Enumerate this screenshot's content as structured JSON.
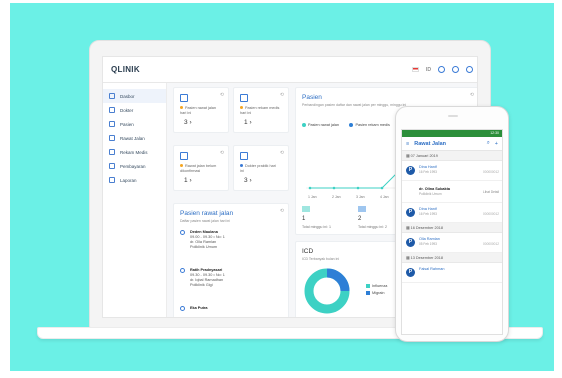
{
  "app": {
    "logo": "QLINIK",
    "language": "ID"
  },
  "sidebar": {
    "items": [
      {
        "label": "Dasbor"
      },
      {
        "label": "Dokter"
      },
      {
        "label": "Pasien"
      },
      {
        "label": "Rawat Jalan"
      },
      {
        "label": "Rekam Medis"
      },
      {
        "label": "Pembayaran"
      },
      {
        "label": "Laporan"
      }
    ]
  },
  "stats": [
    {
      "label": "Pasien rawat jalan hari ini",
      "value": "3"
    },
    {
      "label": "Pasien rekam medis hari ini",
      "value": "1"
    },
    {
      "label": "Rawat jalan belum dikonfirmasi",
      "value": "1"
    },
    {
      "label": "Dokter praktik hari ini",
      "value": "3"
    }
  ],
  "pasien_chart": {
    "title": "Pasien",
    "subtitle": "Perbandingan pasien daftar dan rawat jalan per minggu, minggu ini",
    "legend": [
      "Pasien rawat jalan",
      "Pasien rekam medis"
    ],
    "colors": {
      "rawat": "#3dd1c4",
      "rekam": "#2e7fd6"
    },
    "x_ticks": [
      "1 Jan",
      "2 Jan",
      "3 Jan",
      "4 Jan"
    ],
    "summary": [
      {
        "value": "1",
        "label": "Total minggu ini: 1"
      },
      {
        "value": "2",
        "label": "Total minggu ini: 2"
      }
    ]
  },
  "rawat_jalan": {
    "title": "Pasien rawat jalan",
    "subtitle": "Daftar pasien rawat jalan hari ini",
    "items": [
      {
        "name": "Deden Maulana",
        "time": "09.00 - 09.30 • No: 1",
        "doctor": "dr. Olla Ramlan",
        "poli": "Poliklinik Umum"
      },
      {
        "name": "Ratih Pradnyasari",
        "time": "09.30 - 09.30 • No: 1",
        "doctor": "dr. Iqbal Ramadhan",
        "poli": "Poliklinik Gigi"
      },
      {
        "name": "Eka Putra",
        "time": "",
        "doctor": "",
        "poli": ""
      }
    ]
  },
  "icd": {
    "title": "ICD",
    "subtitle": "ICD Terbanyak bulan ini",
    "legend": [
      "Influenza",
      "Migrain"
    ],
    "colors": {
      "influenza": "#3dd1c4",
      "migrain": "#2e7fd6"
    }
  },
  "phone": {
    "status_time": "12:30",
    "title": "Rawat Jalan",
    "groups": [
      {
        "date": "07 Januari 2019",
        "items": [
          {
            "initial": "P",
            "name": "Dina Hanif",
            "sub": "16 Feb 1993",
            "right": "000000012"
          },
          {
            "initial": "",
            "name": "dr. Olina Subakta",
            "sub": "Poliklinik Umum",
            "right": "Lihat Detail"
          },
          {
            "initial": "P",
            "name": "Dina Hanif",
            "sub": "16 Feb 1993",
            "right": "000000012"
          }
        ]
      },
      {
        "date": "16 Desember 2018",
        "items": [
          {
            "initial": "P",
            "name": "Olla Ramlan",
            "sub": "05 Feb 1993",
            "right": "000000012"
          }
        ]
      },
      {
        "date": "13 Desember 2018",
        "items": [
          {
            "initial": "P",
            "name": "Faisal Rahman",
            "sub": "",
            "right": ""
          }
        ]
      }
    ]
  }
}
